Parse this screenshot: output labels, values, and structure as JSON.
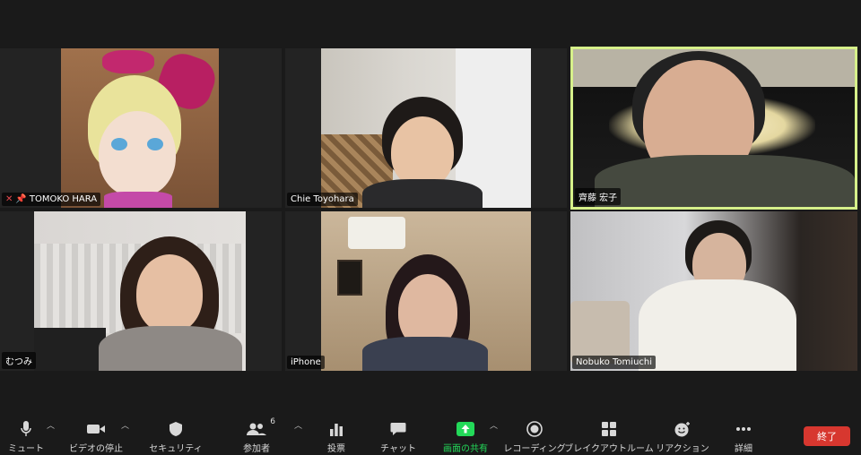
{
  "participants": [
    {
      "name": "TOMOKO HARA",
      "muted": true,
      "pinned": true
    },
    {
      "name": "Chie Toyohara"
    },
    {
      "name": "齊藤 宏子",
      "active_speaker": true
    },
    {
      "name": "むつみ"
    },
    {
      "name": "iPhone"
    },
    {
      "name": "Nobuko Tomiuchi"
    }
  ],
  "toolbar": {
    "mute": "ミュート",
    "video": "ビデオの停止",
    "security": "セキュリティ",
    "participants": "参加者",
    "participants_count": "6",
    "polls": "投票",
    "chat": "チャット",
    "share": "画面の共有",
    "record": "レコーディング",
    "breakout": "ブレイクアウトルーム",
    "reactions": "リアクション",
    "more": "詳細",
    "end": "終了"
  },
  "colors": {
    "active_border": "#d6f08a",
    "share_green": "#23d959",
    "end_red": "#d7372f"
  }
}
